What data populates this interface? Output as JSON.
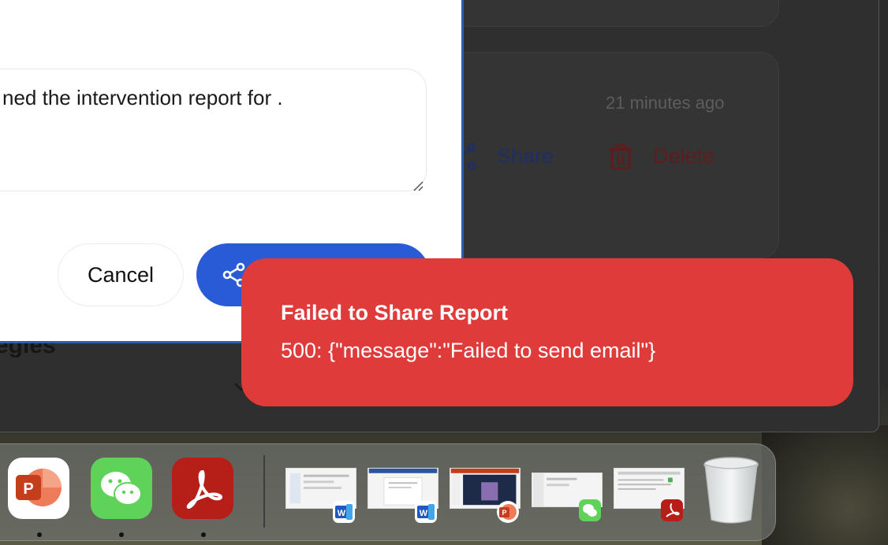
{
  "background_card": {
    "timestamp": "21 minutes ago",
    "share_label": "Share",
    "delete_label": "Delete",
    "section_heading_partial": "egies"
  },
  "share_modal": {
    "message_text": "ned the intervention report for  .",
    "cancel_label": "Cancel",
    "submit_icon": "share-icon"
  },
  "toast": {
    "title": "Failed to Share Report",
    "description": "500: {\"message\":\"Failed to send email\"}",
    "color": "#df3b3b"
  },
  "dock": {
    "apps": [
      {
        "name": "PowerPoint",
        "icon": "powerpoint-icon",
        "running": true
      },
      {
        "name": "WeChat",
        "icon": "wechat-icon",
        "running": true
      },
      {
        "name": "Adobe Acrobat",
        "icon": "acrobat-icon",
        "running": true
      }
    ],
    "windows": [
      {
        "app": "Word",
        "badge": "word-icon"
      },
      {
        "app": "Word",
        "badge": "word-icon"
      },
      {
        "app": "PowerPoint",
        "badge": "powerpoint-icon"
      },
      {
        "app": "WeChat",
        "badge": "wechat-icon"
      },
      {
        "app": "Adobe Acrobat",
        "badge": "acrobat-icon"
      }
    ],
    "trash_icon": "trash-icon"
  },
  "colors": {
    "accent_blue": "#2a5bd7",
    "error_red": "#df3b3b"
  }
}
